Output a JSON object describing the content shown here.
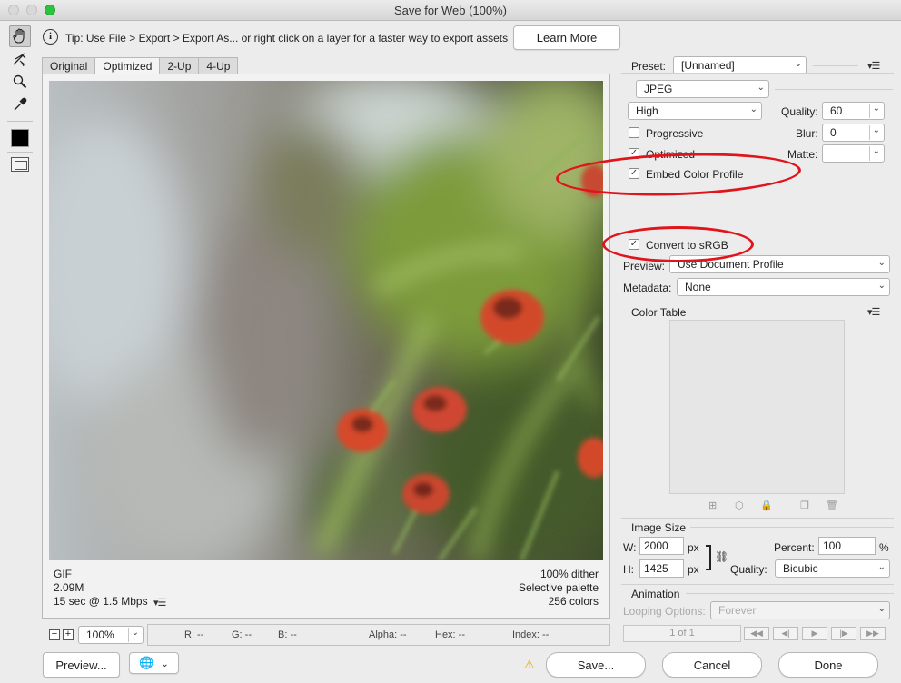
{
  "window": {
    "title": "Save for Web (100%)"
  },
  "tools": [
    "hand-tool",
    "slice-select-tool",
    "zoom-tool",
    "eyedropper-tool"
  ],
  "tip": {
    "text": "Tip: Use File > Export > Export As...  or right click on a layer for a faster way to export assets",
    "learn_more": "Learn More"
  },
  "tabs": [
    "Original",
    "Optimized",
    "2-Up",
    "4-Up"
  ],
  "image_info": {
    "format": "GIF",
    "size": "2.09M",
    "time": "15 sec @ 1.5 Mbps",
    "dither": "100% dither",
    "palette": "Selective palette",
    "colors": "256 colors"
  },
  "zoom": {
    "minus": "−",
    "plus": "+",
    "value": "100%"
  },
  "readouts": {
    "r": "R: --",
    "g": "G: --",
    "b": "B: --",
    "alpha": "Alpha: --",
    "hex": "Hex: --",
    "index": "Index: --"
  },
  "bottom": {
    "preview": "Preview...",
    "save": "Save...",
    "cancel": "Cancel",
    "done": "Done"
  },
  "settings": {
    "preset_label": "Preset:",
    "preset_value": "[Unnamed]",
    "format": "JPEG",
    "quality_level": "High",
    "quality_label": "Quality:",
    "quality_value": "60",
    "progressive": "Progressive",
    "blur_label": "Blur:",
    "blur_value": "0",
    "optimized": "Optimized",
    "matte_label": "Matte:",
    "embed_profile": "Embed Color Profile",
    "convert_srgb": "Convert to sRGB",
    "preview_label": "Preview:",
    "preview_value": "Use Document Profile",
    "metadata_label": "Metadata:",
    "metadata_value": "None"
  },
  "checkboxes": {
    "progressive": false,
    "optimized": true,
    "embed_profile": true,
    "convert_srgb": true
  },
  "color_table": {
    "label": "Color Table"
  },
  "image_size": {
    "label": "Image Size",
    "w_label": "W:",
    "w_value": "2000",
    "h_label": "H:",
    "h_value": "1425",
    "unit": "px",
    "percent_label": "Percent:",
    "percent_value": "100",
    "percent_unit": "%",
    "quality_label": "Quality:",
    "quality_value": "Bicubic"
  },
  "animation": {
    "label": "Animation",
    "looping_label": "Looping Options:",
    "looping_value": "Forever",
    "frame": "1 of 1"
  },
  "colors": {
    "annotation": "#e0141b",
    "window_bg": "#ececec"
  }
}
